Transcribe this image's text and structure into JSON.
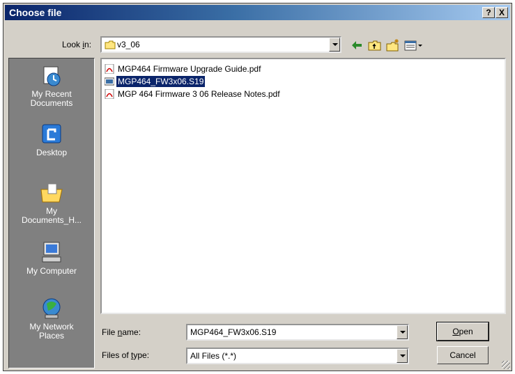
{
  "window": {
    "title": "Choose file",
    "help_label": "?",
    "close_label": "X"
  },
  "lookin": {
    "label_prefix": "Look ",
    "label_u": "i",
    "label_suffix": "n:",
    "value": "v3_06"
  },
  "toolbar": [
    "back-icon",
    "up-folder-icon",
    "new-folder-icon",
    "view-menu-icon"
  ],
  "places": [
    {
      "id": "recent",
      "label1": "My Recent",
      "label2": "Documents",
      "icon": "recent-documents-icon"
    },
    {
      "id": "desktop",
      "label1": "Desktop",
      "label2": "",
      "icon": "desktop-icon"
    },
    {
      "id": "mydocs",
      "label1": "My",
      "label2": "Documents_H...",
      "icon": "my-documents-icon"
    },
    {
      "id": "computer",
      "label1": "My Computer",
      "label2": "",
      "icon": "my-computer-icon"
    },
    {
      "id": "network",
      "label1": "My Network",
      "label2": "Places",
      "icon": "network-places-icon"
    }
  ],
  "files": [
    {
      "name": "MGP464 Firmware Upgrade Guide.pdf",
      "icon": "pdf-file-icon",
      "selected": false
    },
    {
      "name": "MGP464_FW3x06.S19",
      "icon": "generic-file-icon",
      "selected": true
    },
    {
      "name": "MGP 464 Firmware 3 06 Release Notes.pdf",
      "icon": "pdf-file-icon",
      "selected": false
    }
  ],
  "filename": {
    "label_prefix": "File ",
    "label_u": "n",
    "label_suffix": "ame:",
    "value": "MGP464_FW3x06.S19"
  },
  "filetype": {
    "label_prefix": "Files of ",
    "label_u": "t",
    "label_suffix": "ype:",
    "value": "All Files (*.*)"
  },
  "buttons": {
    "open_u": "O",
    "open_rest": "pen",
    "cancel": "Cancel"
  }
}
